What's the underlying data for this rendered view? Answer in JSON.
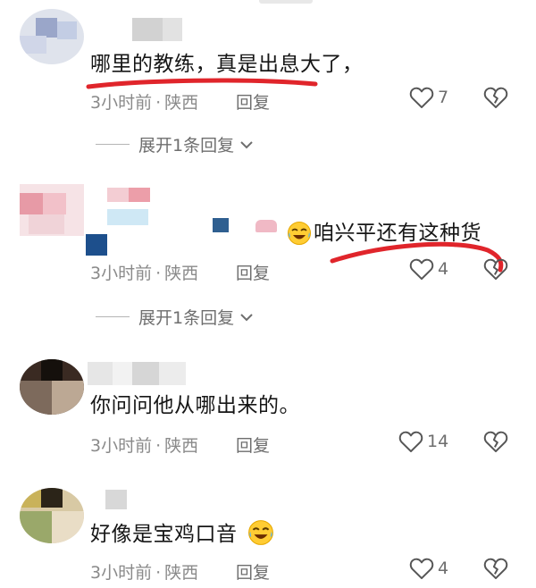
{
  "comments": [
    {
      "text": "哪里的教练，真是出息大了，",
      "time": "3小时前",
      "location": "陕西",
      "reply_label": "回复",
      "likes": "7",
      "expand_label": "展开1条回复"
    },
    {
      "text": "咱兴平还有这种货",
      "time": "3小时前",
      "location": "陕西",
      "reply_label": "回复",
      "likes": "4",
      "expand_label": "展开1条回复"
    },
    {
      "text": "你问问他从哪出来的。",
      "time": "3小时前",
      "location": "陕西",
      "reply_label": "回复",
      "likes": "14"
    },
    {
      "text": "好像是宝鸡口音",
      "time": "3小时前",
      "location": "陕西",
      "reply_label": "回复",
      "likes": "4"
    }
  ],
  "icons": {
    "like": "heart-outline-icon",
    "dislike": "broken-heart-icon",
    "expand": "chevron-down-icon",
    "emoji": "tears-of-joy-emoji"
  },
  "colors": {
    "text": "#161616",
    "meta": "#8a8a8a",
    "annotation_underline": "#e0252b"
  }
}
